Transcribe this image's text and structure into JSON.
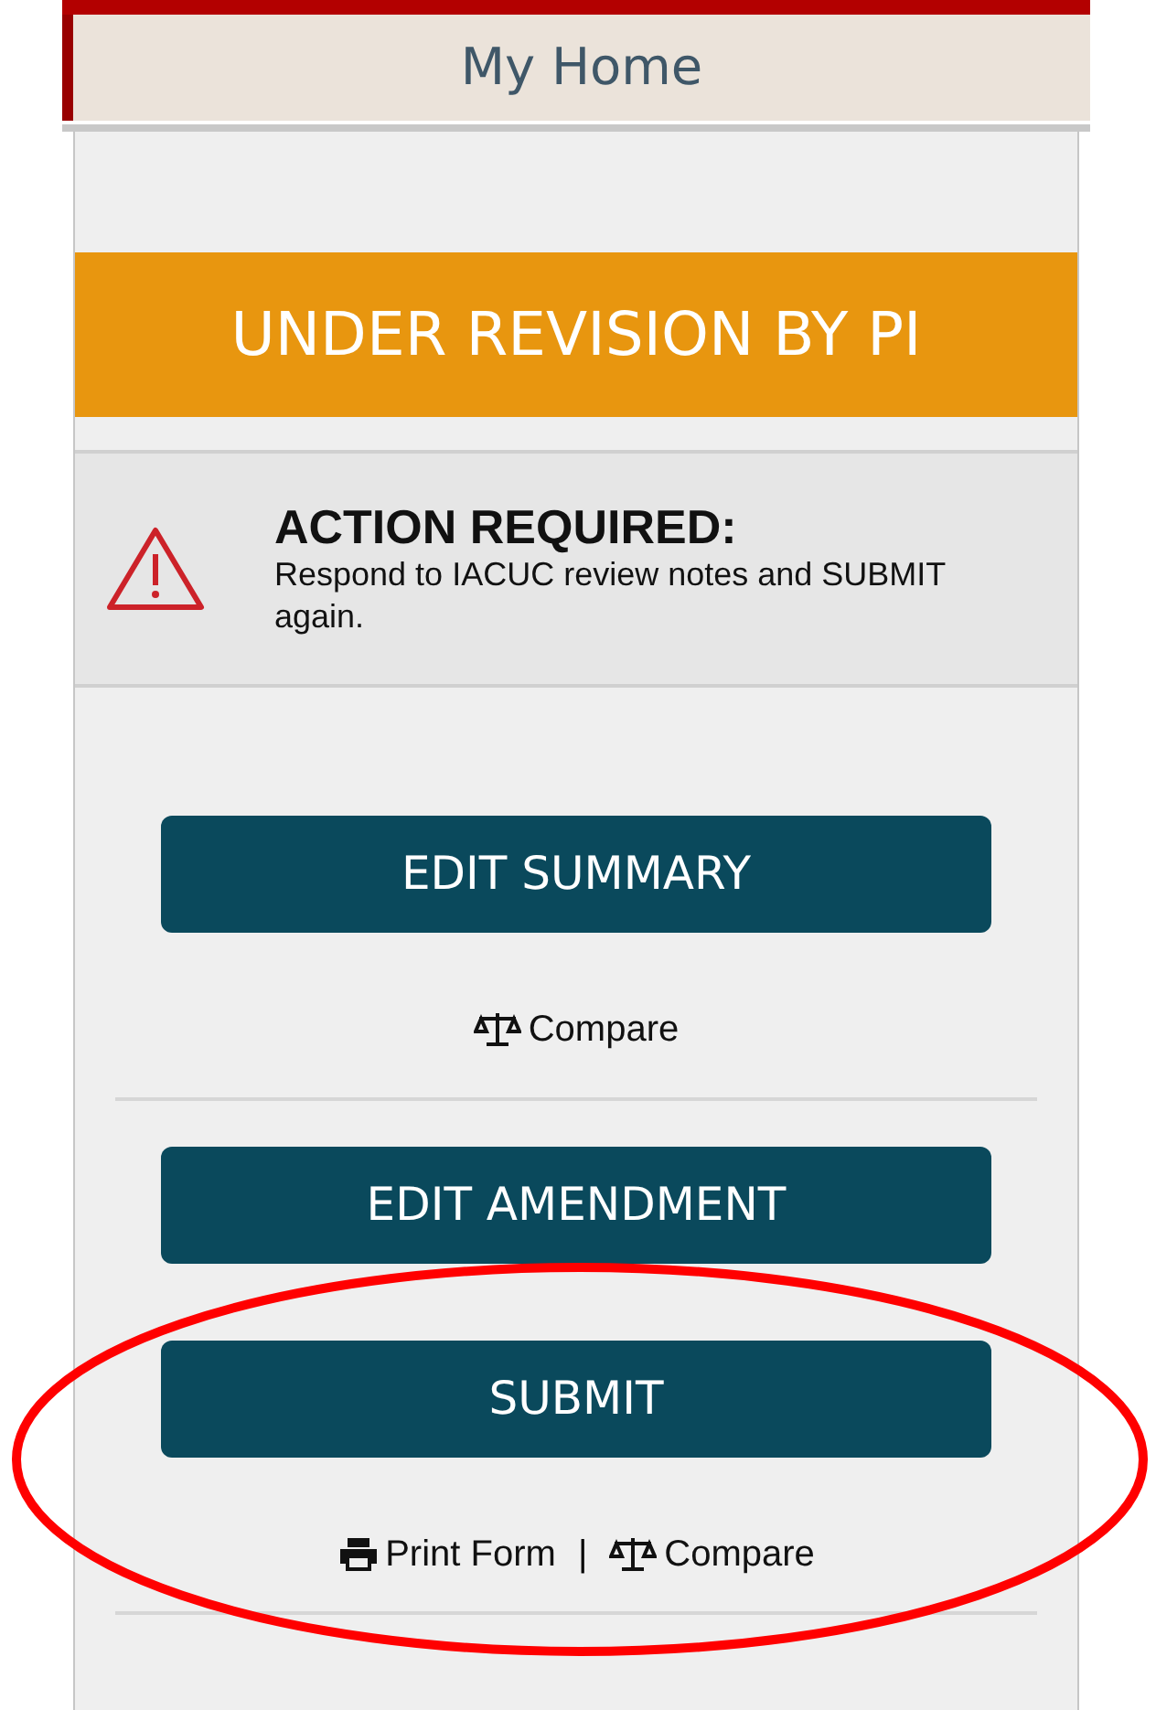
{
  "tab": {
    "label": "My Home"
  },
  "status_banner": {
    "text": "UNDER REVISION BY PI"
  },
  "alert": {
    "title": "ACTION REQUIRED:",
    "message": "Respond to IACUC review notes and SUBMIT again."
  },
  "sections": [
    {
      "buttons": [
        {
          "label": "EDIT SUMMARY"
        }
      ],
      "links": [
        {
          "kind": "compare",
          "label": "Compare"
        }
      ]
    },
    {
      "buttons": [
        {
          "label": "EDIT AMENDMENT"
        },
        {
          "label": "SUBMIT"
        }
      ],
      "links": [
        {
          "kind": "print",
          "label": "Print Form"
        },
        {
          "kind": "separator",
          "label": "|"
        },
        {
          "kind": "compare",
          "label": "Compare"
        }
      ]
    }
  ]
}
